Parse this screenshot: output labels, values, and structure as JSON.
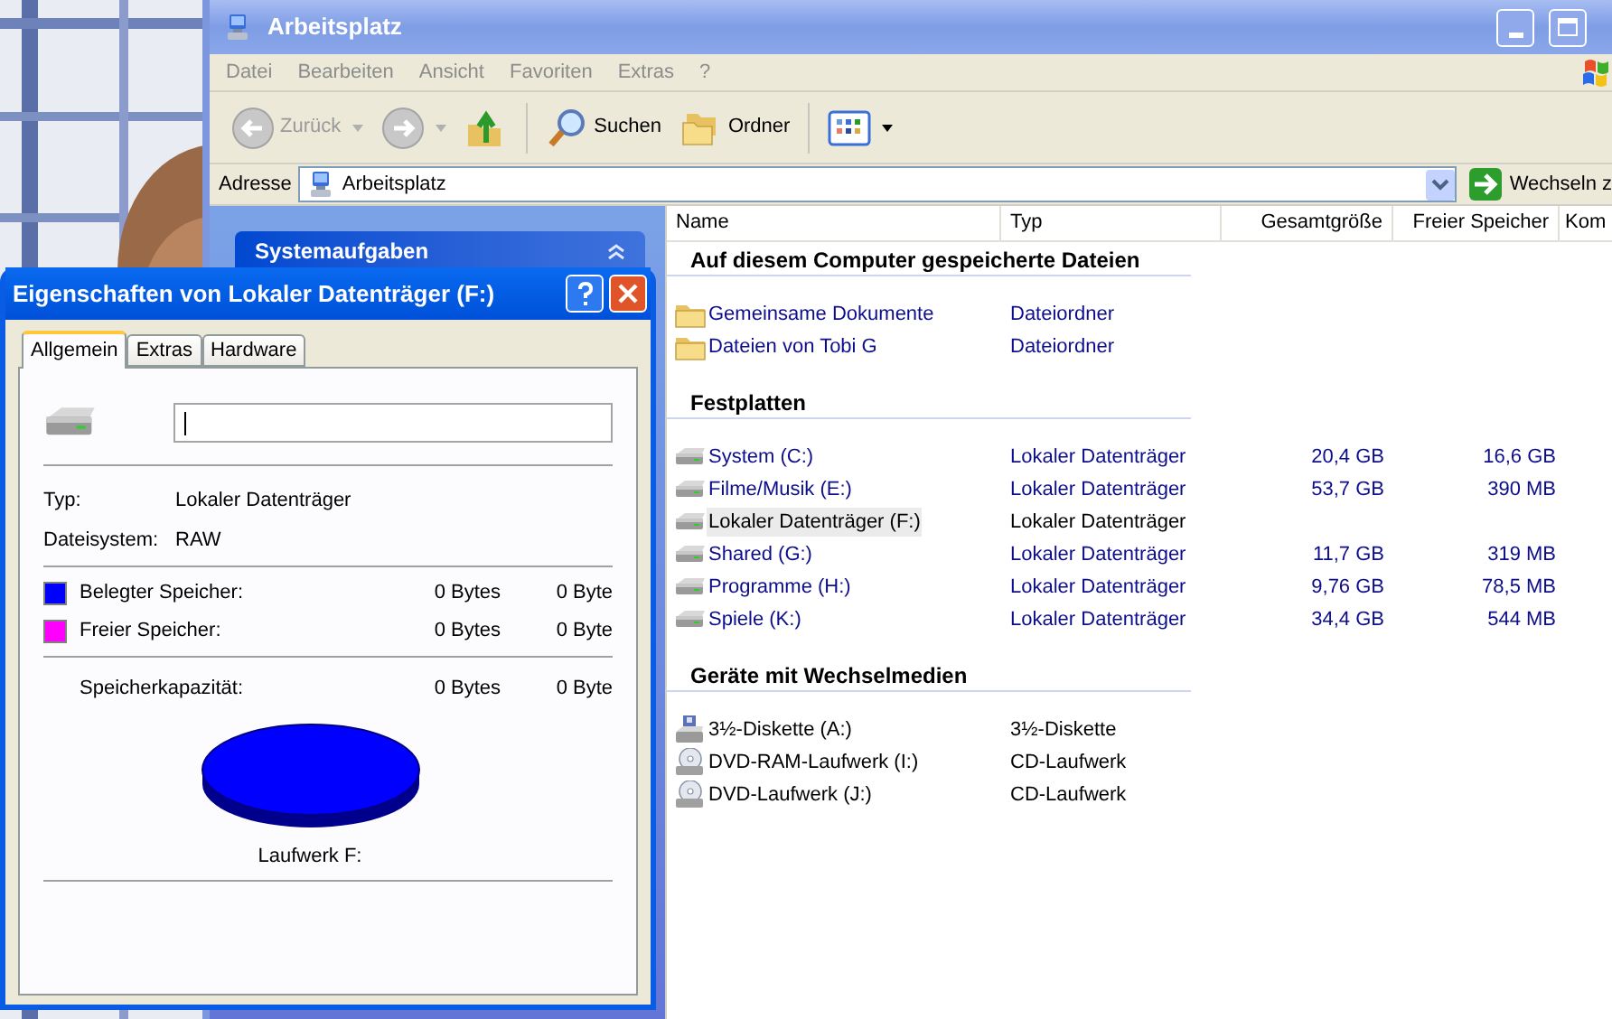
{
  "explorer": {
    "title": "Arbeitsplatz",
    "menu": [
      "Datei",
      "Bearbeiten",
      "Ansicht",
      "Favoriten",
      "Extras",
      "?"
    ],
    "toolbar": [
      {
        "kind": "back",
        "label": "Zurück",
        "disabled": true
      },
      {
        "kind": "forward",
        "disabled": true
      },
      {
        "kind": "up",
        "disabled": false
      },
      {
        "kind": "search",
        "label": "Suchen",
        "disabled": false
      },
      {
        "kind": "folders",
        "label": "Ordner",
        "disabled": false
      },
      {
        "kind": "views",
        "disabled": false
      }
    ],
    "address": {
      "label": "Adresse",
      "value": "Arbeitsplatz",
      "go_label": "Wechseln z"
    },
    "task_pane": {
      "title": "Systemaufgaben",
      "expanded": true
    },
    "columns": [
      "Name",
      "Typ",
      "Gesamtgröße",
      "Freier Speicher",
      "Kom"
    ],
    "groups": [
      {
        "title": "Auf diesem Computer gespeicherte Dateien",
        "items": [
          {
            "kind": "folder",
            "name": "Gemeinsame Dokumente",
            "type": "Dateiordner",
            "selected": false
          },
          {
            "kind": "folder",
            "name": "Dateien von Tobi G",
            "type": "Dateiordner",
            "selected": false
          }
        ]
      },
      {
        "title": "Festplatten",
        "items": [
          {
            "kind": "drive",
            "name": "System (C:)",
            "type": "Lokaler Datenträger",
            "total": "20,4 GB",
            "free": "16,6 GB",
            "selected": false
          },
          {
            "kind": "drive",
            "name": "Filme/Musik (E:)",
            "type": "Lokaler Datenträger",
            "total": "53,7 GB",
            "free": "390 MB",
            "selected": false
          },
          {
            "kind": "drive",
            "name": "Lokaler Datenträger (F:)",
            "type": "Lokaler Datenträger",
            "selected": true
          },
          {
            "kind": "drive",
            "name": "Shared (G:)",
            "type": "Lokaler Datenträger",
            "total": "11,7 GB",
            "free": "319 MB",
            "selected": false
          },
          {
            "kind": "drive",
            "name": "Programme (H:)",
            "type": "Lokaler Datenträger",
            "total": "9,76 GB",
            "free": "78,5 MB",
            "selected": false
          },
          {
            "kind": "drive",
            "name": "Spiele (K:)",
            "type": "Lokaler Datenträger",
            "total": "34,4 GB",
            "free": "544 MB",
            "selected": false
          }
        ]
      },
      {
        "title": "Geräte mit Wechselmedien",
        "items": [
          {
            "kind": "floppy",
            "name": "3½-Diskette (A:)",
            "type": "3½-Diskette",
            "selected": false
          },
          {
            "kind": "cd",
            "name": "DVD-RAM-Laufwerk (I:)",
            "type": "CD-Laufwerk",
            "selected": false
          },
          {
            "kind": "cd",
            "name": "DVD-Laufwerk (J:)",
            "type": "CD-Laufwerk",
            "selected": false
          }
        ]
      }
    ]
  },
  "dialog": {
    "title": "Eigenschaften von Lokaler Datenträger (F:)",
    "tabs": [
      {
        "label": "Allgemein",
        "selected": true
      },
      {
        "label": "Extras",
        "selected": false
      },
      {
        "label": "Hardware",
        "selected": false
      }
    ],
    "fields": [
      {
        "label": "Typ:",
        "value": "Lokaler Datenträger"
      },
      {
        "label": "Dateisystem:",
        "value": "RAW"
      }
    ],
    "usage": [
      {
        "label": "Belegter Speicher:",
        "color": "#0000ff",
        "bytes": "0 Bytes",
        "size": "0 Byte"
      },
      {
        "label": "Freier Speicher:",
        "color": "#ff00ff",
        "bytes": "0 Bytes",
        "size": "0 Byte"
      }
    ],
    "capacity": {
      "label": "Speicherkapazität:",
      "bytes": "0 Bytes",
      "size": "0 Byte"
    },
    "drive_label": "Laufwerk F:"
  }
}
